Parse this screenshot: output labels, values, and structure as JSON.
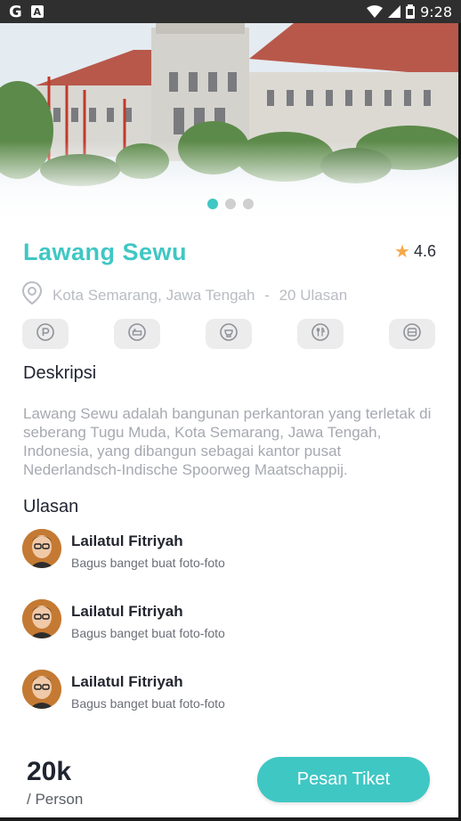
{
  "status_bar": {
    "left_icons": [
      "google-g-icon",
      "a-badge-icon"
    ],
    "g_glyph": "G",
    "a_glyph": "A",
    "time": "9:28"
  },
  "carousel": {
    "image": "lawang-sewu-building-photo",
    "page_count": 3,
    "active_index": 0
  },
  "place": {
    "name": "Lawang Sewu",
    "rating": "4.6",
    "location": "Kota Semarang, Jawa Tengah",
    "separator": "-",
    "reviews_count": "20 Ulasan"
  },
  "facilities": [
    {
      "icon": "parking-icon"
    },
    {
      "icon": "hotel-icon"
    },
    {
      "icon": "toilet-icon"
    },
    {
      "icon": "restaurant-icon"
    },
    {
      "icon": "transport-icon"
    }
  ],
  "description": {
    "heading": "Deskripsi",
    "text": "Lawang Sewu adalah bangunan perkantoran yang terletak di seberang Tugu Muda, Kota Semarang, Jawa Tengah, Indonesia, yang dibangun sebagai kantor pusat Nederlandsch-Indische Spoorweg Maatschappij."
  },
  "reviews": {
    "heading": "Ulasan",
    "items": [
      {
        "name": "Lailatul Fitriyah",
        "comment": "Bagus banget buat foto-foto"
      },
      {
        "name": "Lailatul Fitriyah",
        "comment": "Bagus banget buat foto-foto"
      },
      {
        "name": "Lailatul Fitriyah",
        "comment": "Bagus banget buat foto-foto"
      }
    ]
  },
  "booking": {
    "price": "20k",
    "unit": "/ Person",
    "button_label": "Pesan Tiket"
  },
  "colors": {
    "accent": "#3fc7c4",
    "star": "#f6a94a"
  }
}
